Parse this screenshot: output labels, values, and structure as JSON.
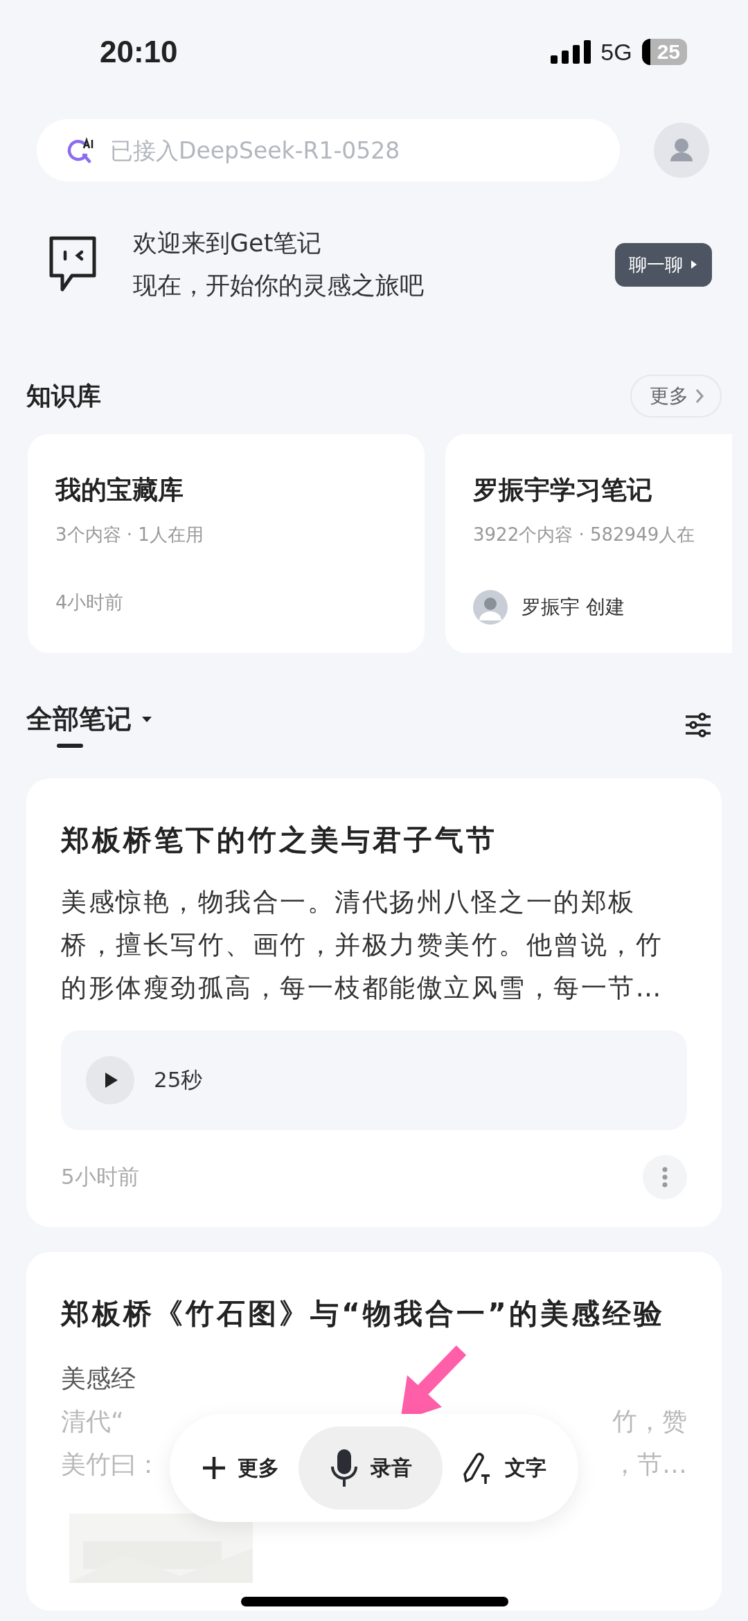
{
  "status_bar": {
    "time": "20:10",
    "network": "5G",
    "battery": "25"
  },
  "search": {
    "placeholder": "已接入DeepSeek-R1-0528"
  },
  "welcome": {
    "line1": "欢迎来到Get笔记",
    "line2": "现在，开始你的灵感之旅吧",
    "button": "聊一聊"
  },
  "knowledge": {
    "title": "知识库",
    "more": "更多",
    "cards": [
      {
        "kind": "own",
        "title": "我的宝藏库",
        "stats": "3个内容 · 1人在用",
        "footer": "4小时前"
      },
      {
        "kind": "creator",
        "title": "罗振宇学习笔记",
        "stats": "3922个内容 · 582949人在",
        "footer": "罗振宇 创建"
      }
    ]
  },
  "notes": {
    "tab": "全部笔记",
    "items": [
      {
        "kind": "audio",
        "title": "郑板桥笔下的竹之美与君子气节",
        "body": "美感惊艳，物我合一。清代扬州八怪之一的郑板桥，擅长写竹、画竹，并极力赞美竹。他曾说，竹的形体瘦劲孤高，每一枝都能傲立风雪，每一节…",
        "audio": "25秒",
        "time": "5小时前"
      },
      {
        "title": "郑板桥《竹石图》与“物我合一”的美感经验",
        "fragments": [
          {
            "left": "美感经"
          },
          {
            "left": "清代“",
            "right": "竹，赞"
          },
          {
            "left": "美竹曰：",
            "right": "，节…"
          }
        ]
      }
    ]
  },
  "dock": [
    {
      "kind": "more",
      "label": "更多",
      "selected": false
    },
    {
      "kind": "record",
      "label": "录音",
      "selected": true
    },
    {
      "kind": "text",
      "label": "文字",
      "selected": false
    }
  ]
}
